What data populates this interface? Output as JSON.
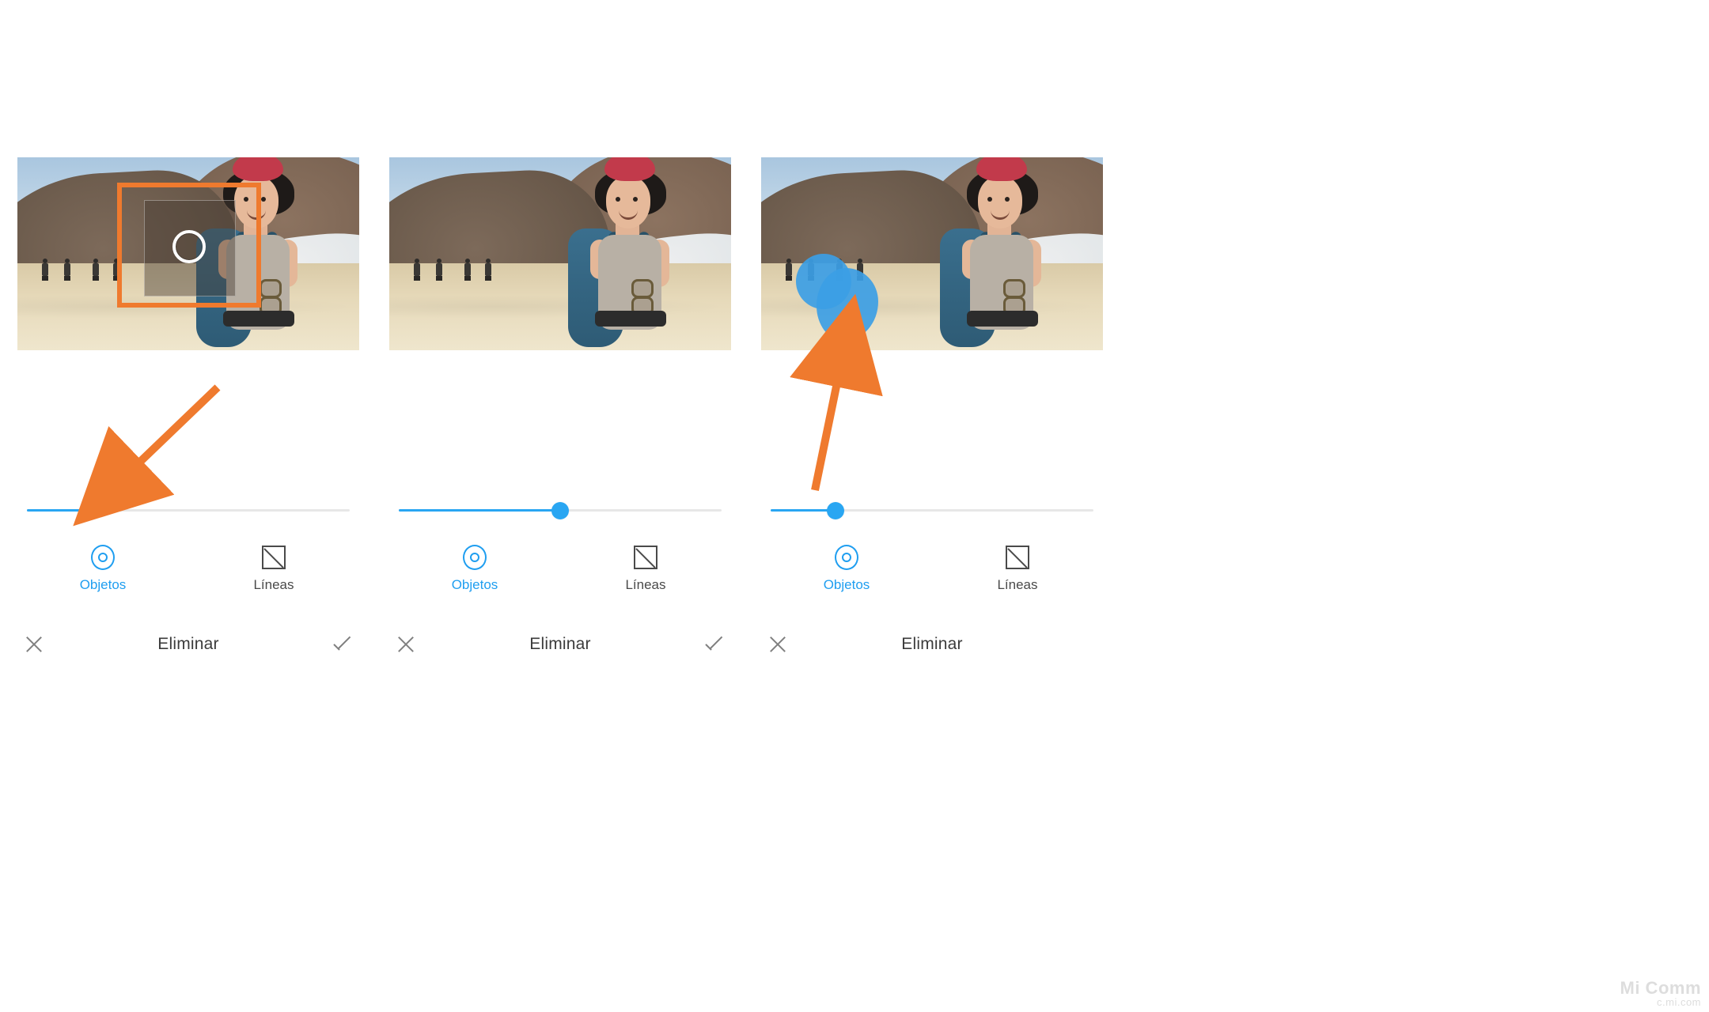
{
  "accent_color": "#29a6f2",
  "annotation_color": "#ef7a2e",
  "watermark": {
    "line1": "Mi Comm",
    "line2": "c.mi.com"
  },
  "panels": [
    {
      "slider_value_percent": 20,
      "modes": {
        "objects": "Objetos",
        "lines": "Líneas",
        "active": "objects"
      },
      "action_bar": {
        "title": "Eliminar"
      },
      "overlay": "selection_box_with_magnifier",
      "annotation_arrow": "to_slider_thumb"
    },
    {
      "slider_value_percent": 50,
      "modes": {
        "objects": "Objetos",
        "lines": "Líneas",
        "active": "objects"
      },
      "action_bar": {
        "title": "Eliminar"
      },
      "overlay": "none",
      "annotation_arrow": "none"
    },
    {
      "slider_value_percent": 20,
      "modes": {
        "objects": "Objetos",
        "lines": "Líneas",
        "active": "objects"
      },
      "action_bar": {
        "title": "Eliminar"
      },
      "overlay": "brush_mask",
      "annotation_arrow": "to_mask"
    }
  ]
}
